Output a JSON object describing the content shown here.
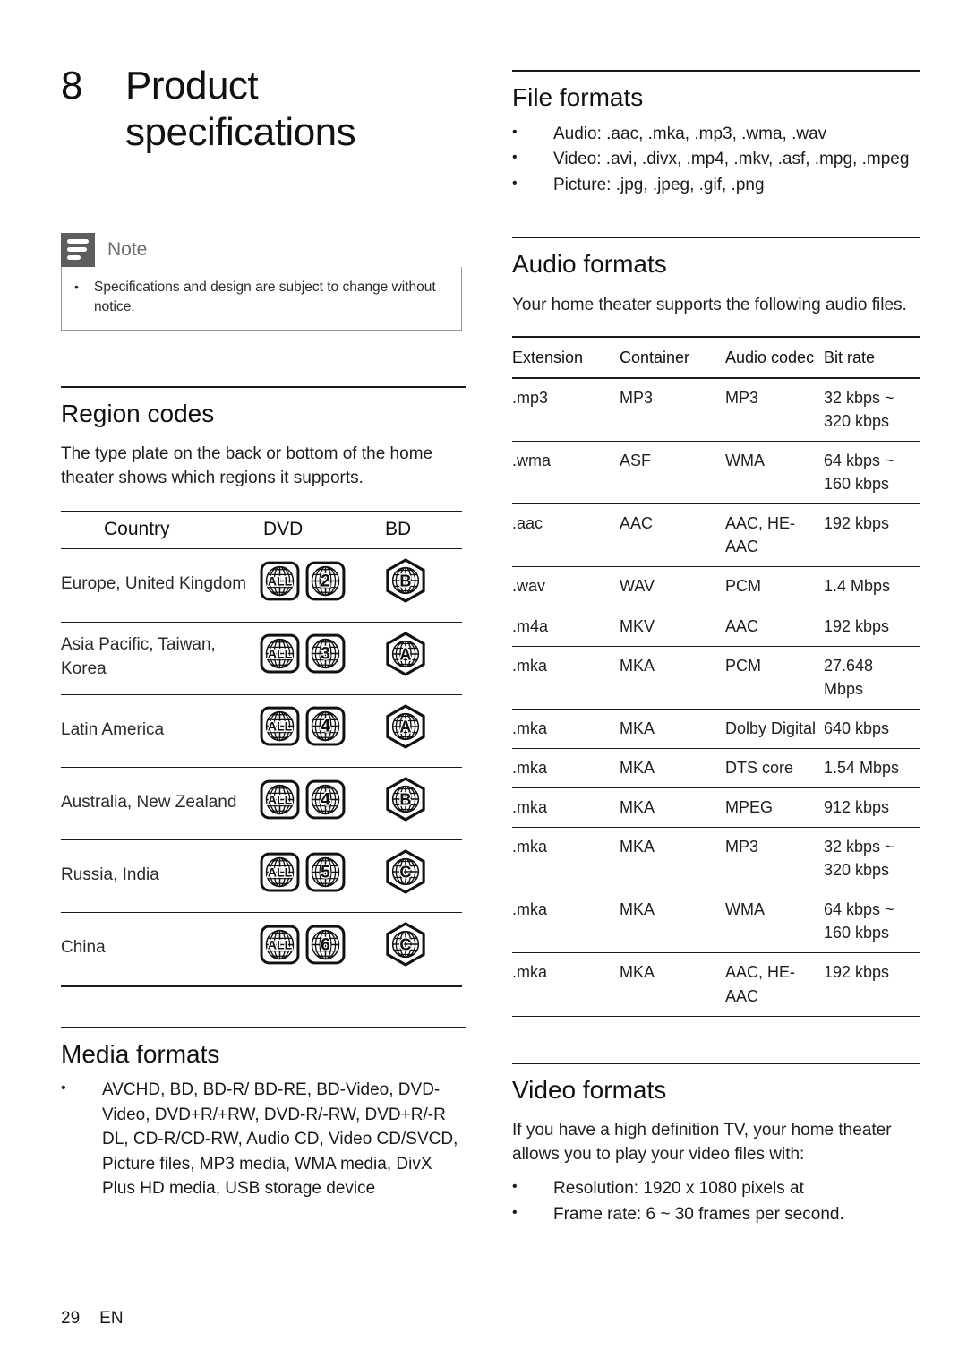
{
  "chapter": {
    "number": "8",
    "title": "Product specifications"
  },
  "note": {
    "label": "Note",
    "bullet": "•",
    "text": "Specifications and design are subject to change without notice."
  },
  "region_codes": {
    "heading": "Region codes",
    "intro": "The type plate on the back or bottom of the home theater shows which regions it supports.",
    "columns": [
      "Country",
      "DVD",
      "BD"
    ],
    "rows": [
      {
        "country": "Europe, United Kingdom",
        "dvd": [
          "ALL",
          "2"
        ],
        "bd": "B"
      },
      {
        "country": "Asia Pacific, Taiwan, Korea",
        "dvd": [
          "ALL",
          "3"
        ],
        "bd": "A"
      },
      {
        "country": "Latin America",
        "dvd": [
          "ALL",
          "4"
        ],
        "bd": "A"
      },
      {
        "country": "Australia, New Zealand",
        "dvd": [
          "ALL",
          "4"
        ],
        "bd": "B"
      },
      {
        "country": "Russia, India",
        "dvd": [
          "ALL",
          "5"
        ],
        "bd": "C"
      },
      {
        "country": "China",
        "dvd": [
          "ALL",
          "6"
        ],
        "bd": "C"
      }
    ]
  },
  "media_formats": {
    "heading": "Media formats",
    "bullet": "•",
    "items": [
      "AVCHD, BD, BD-R/ BD-RE, BD-Video, DVD-Video, DVD+R/+RW, DVD-R/-RW, DVD+R/-R DL, CD-R/CD-RW, Audio CD, Video CD/SVCD, Picture files, MP3 media, WMA media, DivX Plus HD media, USB storage device"
    ]
  },
  "file_formats": {
    "heading": "File formats",
    "bullet": "•",
    "items": [
      "Audio: .aac, .mka, .mp3, .wma, .wav",
      "Video: .avi, .divx, .mp4, .mkv, .asf, .mpg, .mpeg",
      "Picture: .jpg, .jpeg, .gif, .png"
    ]
  },
  "audio_formats": {
    "heading": "Audio formats",
    "intro": "Your home theater supports the following audio files.",
    "columns": [
      "Extension",
      "Container",
      "Audio codec",
      "Bit rate"
    ],
    "rows": [
      {
        "extension": ".mp3",
        "container": "MP3",
        "codec": "MP3",
        "bitrate": "32 kbps ~ 320 kbps"
      },
      {
        "extension": ".wma",
        "container": "ASF",
        "codec": "WMA",
        "bitrate": "64 kbps ~ 160 kbps"
      },
      {
        "extension": ".aac",
        "container": "AAC",
        "codec": "AAC, HE-AAC",
        "bitrate": "192 kbps"
      },
      {
        "extension": ".wav",
        "container": "WAV",
        "codec": "PCM",
        "bitrate": "1.4 Mbps"
      },
      {
        "extension": ".m4a",
        "container": "MKV",
        "codec": "AAC",
        "bitrate": "192 kbps"
      },
      {
        "extension": ".mka",
        "container": "MKA",
        "codec": "PCM",
        "bitrate": "27.648 Mbps"
      },
      {
        "extension": ".mka",
        "container": "MKA",
        "codec": "Dolby Digital",
        "bitrate": "640 kbps"
      },
      {
        "extension": ".mka",
        "container": "MKA",
        "codec": "DTS core",
        "bitrate": "1.54 Mbps"
      },
      {
        "extension": ".mka",
        "container": "MKA",
        "codec": "MPEG",
        "bitrate": "912 kbps"
      },
      {
        "extension": ".mka",
        "container": "MKA",
        "codec": "MP3",
        "bitrate": "32 kbps ~ 320 kbps"
      },
      {
        "extension": ".mka",
        "container": "MKA",
        "codec": "WMA",
        "bitrate": "64 kbps ~ 160 kbps"
      },
      {
        "extension": ".mka",
        "container": "MKA",
        "codec": "AAC, HE- AAC",
        "bitrate": "192 kbps"
      }
    ]
  },
  "video_formats": {
    "heading": "Video formats",
    "intro": "If you have a high definition TV, your home theater allows you to play your video files with:",
    "bullet": "•",
    "items": [
      "Resolution: 1920 x 1080 pixels at",
      "Frame rate: 6 ~ 30 frames per second."
    ]
  },
  "footer": {
    "page_number": "29",
    "language": "EN"
  }
}
